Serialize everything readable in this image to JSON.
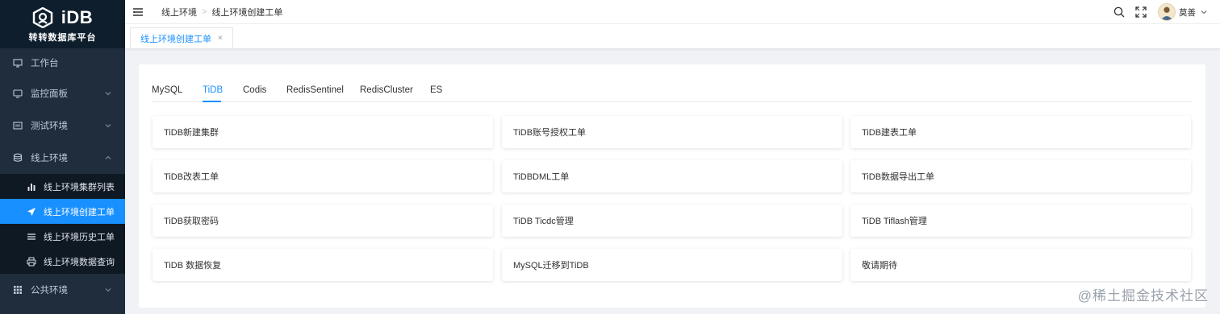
{
  "brand": {
    "name": "iDB",
    "subtitle": "转转数据库平台"
  },
  "sidebar": {
    "items": [
      {
        "label": "工作台",
        "icon": "workbench-icon"
      },
      {
        "label": "监控面板",
        "icon": "monitor-icon"
      },
      {
        "label": "测试环境",
        "icon": "test-env-icon"
      },
      {
        "label": "线上环境",
        "icon": "database-icon"
      },
      {
        "label": "公共环境",
        "icon": "grid-icon"
      }
    ],
    "online_sub": [
      {
        "label": "线上环境集群列表",
        "icon": "bar-chart-icon"
      },
      {
        "label": "线上环境创建工单",
        "icon": "send-icon"
      },
      {
        "label": "线上环境历史工单",
        "icon": "list-icon"
      },
      {
        "label": "线上环境数据查询",
        "icon": "printer-icon"
      }
    ]
  },
  "header": {
    "breadcrumb": [
      "线上环境",
      "线上环境创建工单"
    ],
    "user_name": "莫善"
  },
  "tags_view": {
    "active_tag": "线上环境创建工单",
    "close_glyph": "×"
  },
  "tabs": [
    "MySQL",
    "TiDB",
    "Codis",
    "RedisSentinel",
    "RedisCluster",
    "ES"
  ],
  "active_tab": "TiDB",
  "tiles": [
    "TiDB新建集群",
    "TiDB账号授权工单",
    "TiDB建表工单",
    "TiDB改表工单",
    "TiDBDML工单",
    "TiDB数据导出工单",
    "TiDB获取密码",
    "TiDB Ticdc管理",
    "TiDB Tiflash管理",
    "TiDB 数据恢复",
    "MySQL迁移到TiDB",
    "敬请期待"
  ],
  "watermark": "@稀土掘金技术社区",
  "colors": {
    "accent": "#1890ff",
    "sidebar_bg": "#1f2d3d",
    "brand_bg": "#0e1e2d",
    "submenu_bg": "#0f1924"
  }
}
